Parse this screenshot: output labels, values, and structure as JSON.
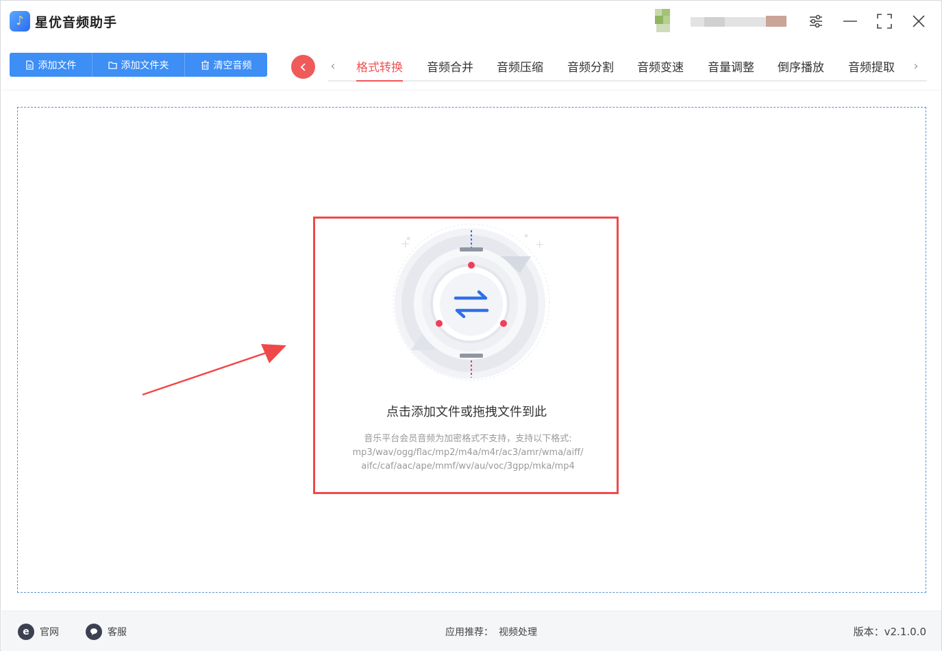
{
  "app": {
    "title": "星优音频助手"
  },
  "toolbar": {
    "add_file": "添加文件",
    "add_folder": "添加文件夹",
    "clear_audio": "清空音频"
  },
  "tabs": [
    {
      "label": "格式转换",
      "active": true
    },
    {
      "label": "音频合并"
    },
    {
      "label": "音频压缩"
    },
    {
      "label": "音频分割"
    },
    {
      "label": "音频变速"
    },
    {
      "label": "音量调整"
    },
    {
      "label": "倒序播放"
    },
    {
      "label": "音频提取"
    }
  ],
  "dropzone": {
    "title": "点击添加文件或拖拽文件到此",
    "desc_line1": "音乐平台会员音频为加密格式不支持，支持以下格式:",
    "desc_line2": "mp3/wav/ogg/flac/mp2/m4a/m4r/ac3/amr/wma/aiff/",
    "desc_line3": "aifc/caf/aac/ape/mmf/wv/au/voc/3gpp/mka/mp4"
  },
  "footer": {
    "website": "官网",
    "support": "客服",
    "recommend_label": "应用推荐：",
    "recommend_link": "视频处理",
    "version": "版本：v2.1.0.0"
  },
  "colors": {
    "accent_blue": "#3d8ef5",
    "accent_red": "#f05454",
    "highlight_red": "#f04848"
  }
}
